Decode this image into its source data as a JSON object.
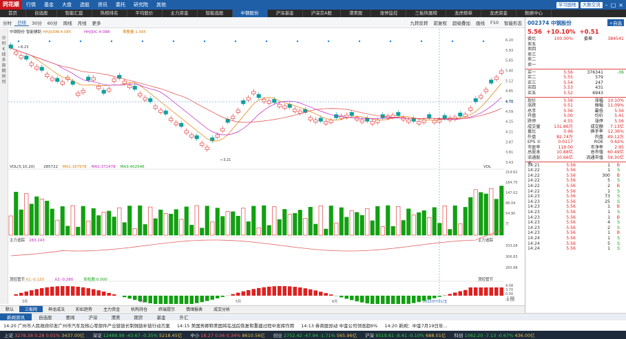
{
  "topbar": {
    "logo": "同花顺",
    "menus": [
      "行情",
      "基金",
      "大盘",
      "选股",
      "资讯",
      "委托",
      "研究院",
      "其他"
    ],
    "right_buttons": [
      "学习园地",
      "大数交流"
    ]
  },
  "navtabs": [
    "首页",
    "自选股",
    "智能汇盘",
    "热榜排名",
    "平均股价",
    "主力资金",
    "智能选股",
    "中钢股份",
    "沪深基金",
    "沪深京A股",
    "港美股",
    "涨停监控",
    "三板所属榜",
    "龙虎榜单",
    "龙虎资金",
    "数据中心"
  ],
  "nav_active_index": 7,
  "chartbar": {
    "buttons": [
      "分时",
      "日线",
      "30分",
      "60分",
      "周线",
      "月线",
      "更多"
    ],
    "active": "日线",
    "right_buttons": [
      "九转反转",
      "前复权",
      "超级叠加",
      "画线",
      "F10",
      "智能形态"
    ]
  },
  "indicators": {
    "ma": "中钢股份",
    "ma_tool": "智能辅助",
    "ma1": "HH/JUDB:4.085",
    "ma2": "HH/JDC:4.088",
    "ma3": "堆叠量:1.095",
    "vol_label": "VOL(5,10,20)",
    "vol_val": "285722",
    "vol_ma1": "MA1:167578",
    "vol_ma2": "MA2:371478",
    "vol_ma3": "MA3:402546",
    "vol_right": "VOL",
    "main_label": "主力追踪",
    "main_val": "283.243",
    "main_right": "主力追踪",
    "bot_label": "顶控管节",
    "bot_x1": "X1:-0.120",
    "bot_x2": "X2:-0.280",
    "bot_x3": "彩柱数:0.000",
    "bot_right": "顶控管节"
  },
  "chart_data": {
    "type": "candlestick",
    "y_ticks": [
      "6.20",
      "5.93",
      "5.65",
      "5.40",
      "5.12",
      "4.85",
      "4.70",
      "4.59",
      "4.15",
      "4.11",
      "3.87",
      "3.81",
      "3.43"
    ],
    "price_labels": {
      "high": "6.23",
      "low": "3.21",
      "cursor": "4.70"
    },
    "vol_ticks": [
      "219.62",
      "184.75",
      "147.02",
      "88.04",
      "54.90",
      "万"
    ],
    "main_ticks": [
      "333.08",
      "306.83",
      "283.88"
    ],
    "bot_ticks": [
      "4.08",
      "3.70",
      "0.00",
      "-1.88",
      "-4.58"
    ],
    "x_labels": [
      "3月",
      "4月",
      "5月",
      "6月"
    ],
    "cursor_date": "2022/07/01/五"
  },
  "left_strip": [
    "分",
    "时",
    "K",
    "线",
    "多",
    "周",
    "期",
    "同",
    "列"
  ],
  "right": {
    "code": "002374",
    "name": "中钢股份",
    "add_label": "+自选",
    "price": "5.56",
    "change": "+10.10%",
    "change_amt": "+0.51",
    "weibi_label": "委比",
    "weibi": "100.00%",
    "weicha_label": "委差",
    "weicha": "384541",
    "asks": [
      [
        "卖五",
        "",
        ""
      ],
      [
        "卖四",
        "",
        ""
      ],
      [
        "卖三",
        "",
        ""
      ],
      [
        "卖二",
        "",
        ""
      ],
      [
        "卖一",
        "",
        ""
      ]
    ],
    "bids": [
      [
        "买一",
        "5.56",
        "376341",
        "-36"
      ],
      [
        "买二",
        "5.55",
        "579",
        ""
      ],
      [
        "买三",
        "5.54",
        "247",
        ""
      ],
      [
        "买四",
        "5.53",
        "431",
        ""
      ],
      [
        "买五",
        "5.52",
        "6943",
        ""
      ]
    ],
    "stats": [
      [
        "现价",
        "5.56",
        "涨幅",
        "10.10%"
      ],
      [
        "涨跌",
        "0.51",
        "振幅",
        "11.09%"
      ],
      [
        "总手",
        "5.56",
        "最低",
        "5.56"
      ],
      [
        "开盘",
        "5.00",
        "均价",
        "5.41"
      ],
      [
        "跌停",
        "4.55",
        "涨停",
        "5.56"
      ]
    ],
    "stats2": [
      [
        "成交量",
        "131.86万",
        "成交额",
        "7.13亿"
      ],
      [
        "量比",
        "0.96",
        "换手率",
        "12.36%"
      ],
      [
        "外盘",
        "82.74万",
        "内盘",
        "49.12万"
      ],
      [
        "EPS ①",
        "0.0117",
        "ROE",
        "0.62%"
      ],
      [
        "市盈率",
        "119.00",
        "市净率",
        "2.95"
      ],
      [
        "总股本",
        "10.88亿",
        "总市值",
        "60.49亿"
      ],
      [
        "流通股本",
        "10.66亿",
        "流通市值",
        "59.30亿"
      ]
    ],
    "ticks": [
      [
        "14:21",
        "5.56",
        "1"
      ],
      [
        "14:22",
        "5.56",
        "1"
      ],
      [
        "14:22",
        "5.56",
        "300"
      ],
      [
        "14:22",
        "5.56",
        "5"
      ],
      [
        "14:22",
        "5.56",
        "2"
      ],
      [
        "14:22",
        "5.56",
        "1"
      ],
      [
        "14:23",
        "5.56",
        "73"
      ],
      [
        "14:23",
        "5.56",
        "25"
      ],
      [
        "14:23",
        "5.56",
        "1"
      ],
      [
        "14:23",
        "5.56",
        "1"
      ],
      [
        "14:23",
        "5.56",
        "1"
      ],
      [
        "14:23",
        "5.56",
        "4"
      ],
      [
        "14:23",
        "5.56",
        "2"
      ],
      [
        "14:23",
        "5.56",
        "1"
      ],
      [
        "14:24",
        "5.56",
        "1"
      ],
      [
        "14:24",
        "5.56",
        "5"
      ],
      [
        "14:24",
        "5.56",
        "1"
      ]
    ],
    "tick_letters": [
      "B",
      "S",
      "B",
      "S",
      "B",
      "S",
      "S",
      "S",
      "B",
      "S",
      "B",
      "S",
      "S",
      "B",
      "S",
      "S",
      "S"
    ]
  },
  "bottomtabs": [
    "默认",
    "三板网",
    "神龙成法",
    "彩虹趋势",
    "主力资金",
    "机构持仓",
    "终端提示",
    "情绪报表",
    "成交分析"
  ],
  "newstabs": [
    "新闻资讯",
    "自选股",
    "要闻",
    "沪深",
    "港美",
    "期货",
    "基金",
    "外汇"
  ],
  "news": [
    "14:20 广州市人民政府印发广州市汽车及核心零部件产业链链长制强链补链行动方案",
    "14:15 美国务卿称美国将在战后恢复和重建过程中发挥作用",
    "14:13 券商股异动 中金公司领涨超6%",
    "14:20 新闻：中金7月19日年..."
  ],
  "status": [
    {
      "name": "上证",
      "val": "3278.38",
      "chg": "0.28",
      "pct": "0.01%",
      "amt": "3437.00亿"
    },
    {
      "name": "深证",
      "val": "12488.99",
      "chg": "-43.67",
      "pct": "-0.35%",
      "amt": "5218.45亿"
    },
    {
      "name": "中小",
      "val": "18.27",
      "chg": "0.06",
      "pct": "0.34%",
      "amt": "8610.56亿"
    },
    {
      "name": "创业",
      "val": "2752.42",
      "chg": "-47.94",
      "pct": "-1.71%",
      "amt": "565.96亿"
    },
    {
      "name": "沪深",
      "val": "8519.61",
      "chg": "-8.41",
      "pct": "-0.10%",
      "amt": "688.01亿"
    },
    {
      "name": "科创",
      "val": "1062.20",
      "chg": "-7.13",
      "pct": "-0.67%",
      "amt": "436.00亿"
    }
  ]
}
